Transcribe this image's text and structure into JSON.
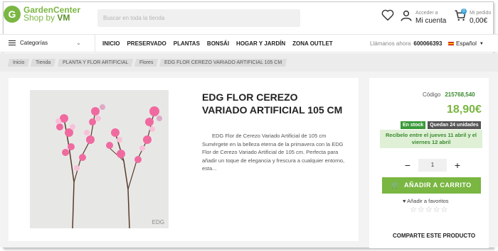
{
  "header": {
    "logo_mark": "G",
    "logo_line1": "GardenCenter",
    "logo_line2a": "Shop by ",
    "logo_line2b": "VM",
    "search_placeholder": "Buscar en toda la tienda",
    "account_small": "Acceder a",
    "account_big": "Mi cuenta",
    "cart_count": "0",
    "order_small": "Mi pedido",
    "order_total": "0,00€"
  },
  "nav": {
    "categories_label": "Categorías",
    "items": [
      "INICIO",
      "PRESERVADO",
      "PLANTAS",
      "BONSÁI",
      "HOGAR Y JARDÍN",
      "ZONA OUTLET"
    ],
    "phone_label": "Llámanos ahora",
    "phone_number": "600066393",
    "language": "Español"
  },
  "breadcrumb": [
    "Inicio",
    "Tienda",
    "PLANTA Y FLOR ARTIFICIAL",
    "Flores",
    "EDG FLOR CEREZO VARIADO ARTIFICIAL 105 CM"
  ],
  "product": {
    "title": "EDG FLOR CEREZO VARIADO ARTIFICIAL 105 CM",
    "desc_line1": "EDG Flor de Cerezo Variado Artificial de 105 cm",
    "desc_rest": "Sumérgete en la belleza eterna de la primavera con la EDG Flor de Cerezo Variado Artificial de 105 cm. Perfecta para añadir un toque de elegancia y frescura a cualquier entorno, esta...",
    "image_watermark": "EDG"
  },
  "side": {
    "code_label": "Código",
    "code_value": "215768,540",
    "price": "18,90€",
    "stock_badge": "En stock",
    "units_badge": "Quedan 24 unidades",
    "shipping": "Recíbelo entre el jueves 11 abril y el viernes 12 abril",
    "qty_minus": "−",
    "qty_value": "1",
    "qty_plus": "+",
    "add_to_cart": "AÑADIR A CARRITO",
    "favorites": "Añadir a favoritos",
    "share": "COMPARTE ESTE PRODUCTO",
    "rating": 0
  },
  "colors": {
    "brand": "#7ab642",
    "stock": "#3a9a3a",
    "accent_dark": "#3a8a2e"
  }
}
